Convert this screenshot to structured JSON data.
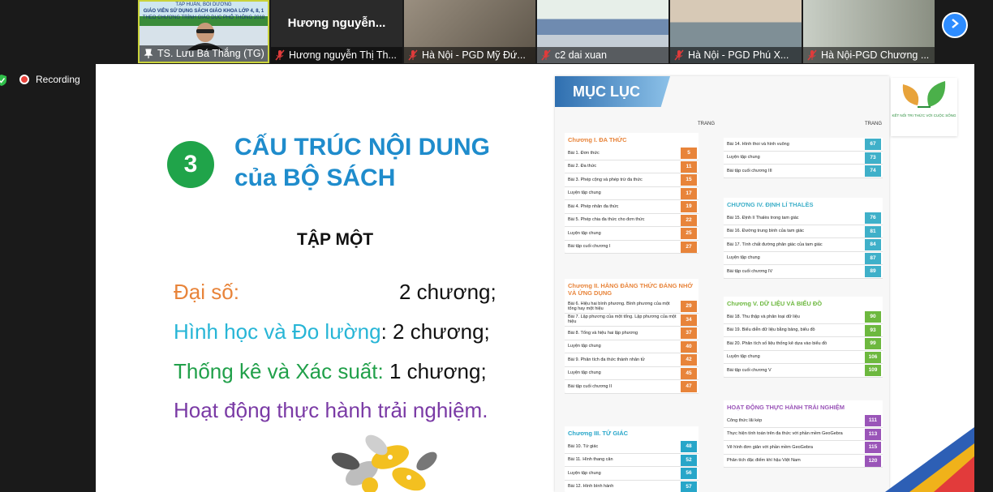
{
  "participants": [
    {
      "name": "TS. Lưu Bá Thắng (TG)",
      "muted": false,
      "active": true,
      "banner_lines": [
        "TẬP HUẤN, BỒI DƯỠNG",
        "GIÁO VIÊN SỬ DỤNG SÁCH GIÁO KHOA LỚP 4, 8, 1",
        "THEO CHƯƠNG TRÌNH GIÁO DỤC PHỔ THÔNG 2018"
      ]
    },
    {
      "name": "Hương nguyễn Thị Th...",
      "display_name": "Hương  nguyễn...",
      "muted": true,
      "active": false
    },
    {
      "name": "Hà Nội - PGD Mỹ Đứ...",
      "muted": true,
      "active": false
    },
    {
      "name": "c2 dai xuan",
      "muted": true,
      "active": false
    },
    {
      "name": "Hà Nội  - PGD Phú X...",
      "muted": true,
      "active": false
    },
    {
      "name": "Hà Nội-PGD Chương ...",
      "muted": true,
      "active": false
    }
  ],
  "recording": {
    "label": "Recording",
    "color": "#e8413a"
  },
  "icons": {
    "next": "chevron-right-icon",
    "record": "record-dot-icon",
    "mic": "mic-muted-icon",
    "shield": "shield-check-icon"
  },
  "slide": {
    "number": "3",
    "title_line1": "CẤU TRÚC NỘI DUNG",
    "title_line2": "của BỘ SÁCH",
    "volume": "TẬP MỘT",
    "lines": [
      {
        "label": "Đại số:",
        "value": "2 chương;"
      },
      {
        "label": "Hình học và Đo lường",
        "value": ": 2 chương;"
      },
      {
        "label": "Thống kê và Xác suất:",
        "value": "  1 chương;"
      },
      {
        "label": "Hoạt động thực hành trải nghiệm."
      }
    ],
    "colors": {
      "number_bg": "#20a44a",
      "title": "#1f8ccc",
      "algebra": "#e8843a",
      "geometry": "#27b5d6",
      "stats": "#21a04a",
      "practice": "#7a3aa5"
    }
  },
  "book": {
    "banner": "MỤC LỤC",
    "page_header": "TRANG",
    "logo_caption": "KẾT NỐI TRI THỨC VỚI CUỘC SỐNG",
    "left": [
      {
        "title": "Chương I. ĐA THỨC",
        "color": "#e8843a",
        "items": [
          {
            "t": "Bài 1. Đơn thức",
            "p": "5"
          },
          {
            "t": "Bài 2. Đa thức",
            "p": "11"
          },
          {
            "t": "Bài 3. Phép cộng và phép trừ đa thức",
            "p": "15"
          },
          {
            "t": "Luyện tập chung",
            "p": "17"
          },
          {
            "t": "Bài 4. Phép nhân đa thức",
            "p": "19"
          },
          {
            "t": "Bài 5. Phép chia đa thức cho đơn thức",
            "p": "22"
          },
          {
            "t": "Luyện tập chung",
            "p": "25"
          },
          {
            "t": "Bài tập cuối chương I",
            "p": "27"
          }
        ]
      },
      {
        "title": "Chương II. HẰNG ĐẲNG THỨC ĐÁNG NHỚ VÀ ỨNG DỤNG",
        "color": "#e8843a",
        "items": [
          {
            "t": "Bài 6. Hiệu hai bình phương. Bình phương của một tổng hay một hiệu",
            "p": "29"
          },
          {
            "t": "Bài 7. Lập phương của một tổng. Lập phương của một hiệu",
            "p": "34"
          },
          {
            "t": "Bài 8. Tổng và hiệu hai lập phương",
            "p": "37"
          },
          {
            "t": "Luyện tập chung",
            "p": "40"
          },
          {
            "t": "Bài 9. Phân tích đa thức thành nhân tử",
            "p": "42"
          },
          {
            "t": "Luyện tập chung",
            "p": "45"
          },
          {
            "t": "Bài tập cuối chương II",
            "p": "47"
          }
        ]
      },
      {
        "title": "Chương III. TỨ GIÁC",
        "color": "#27a6c9",
        "items": [
          {
            "t": "Bài 10. Tứ giác",
            "p": "48"
          },
          {
            "t": "Bài 11. Hình thang cân",
            "p": "52"
          },
          {
            "t": "Luyện tập chung",
            "p": "56"
          },
          {
            "t": "Bài 12. Hình bình hành",
            "p": "57"
          }
        ]
      }
    ],
    "right": [
      {
        "title": "",
        "color": "#3fb0c9",
        "items": [
          {
            "t": "Bài 14. Hình thoi và hình vuông",
            "p": "67"
          },
          {
            "t": "Luyện tập chung",
            "p": "73"
          },
          {
            "t": "Bài tập cuối chương III",
            "p": "74"
          }
        ]
      },
      {
        "title": "CHƯƠNG IV. ĐỊNH LÍ THALÈS",
        "color": "#3fb0c9",
        "items": [
          {
            "t": "Bài 15. Định lí Thalès trong tam giác",
            "p": "76"
          },
          {
            "t": "Bài 16. Đường trung bình của tam giác",
            "p": "81"
          },
          {
            "t": "Bài 17. Tính chất đường phân giác của tam giác",
            "p": "84"
          },
          {
            "t": "Luyện tập chung",
            "p": "87"
          },
          {
            "t": "Bài tập cuối chương IV",
            "p": "89"
          }
        ]
      },
      {
        "title": "Chương V. DỮ LIỆU VÀ BIỂU ĐỒ",
        "color": "#6db83f",
        "items": [
          {
            "t": "Bài 18. Thu thập và phân loại dữ liệu",
            "p": "90"
          },
          {
            "t": "Bài 19. Biểu diễn dữ liệu bằng bảng, biểu đồ",
            "p": "93"
          },
          {
            "t": "Bài 20. Phân tích số liệu thống kê dựa vào biểu đồ",
            "p": "99"
          },
          {
            "t": "Luyện tập chung",
            "p": "106"
          },
          {
            "t": "Bài tập cuối chương V",
            "p": "109"
          }
        ]
      },
      {
        "title": "HOẠT ĐỘNG THỰC HÀNH TRẢI NGHIỆM",
        "color": "#9a55b8",
        "items": [
          {
            "t": "Công thức lãi kép",
            "p": "111"
          },
          {
            "t": "Thực hiện tính toán trên đa thức với phần mềm GeoGebra",
            "p": "113"
          },
          {
            "t": "Vẽ hình đơn giản với phần mềm GeoGebra",
            "p": "115"
          },
          {
            "t": "Phân tích đặc điểm khí hậu Việt Nam",
            "p": "120"
          }
        ]
      }
    ]
  }
}
